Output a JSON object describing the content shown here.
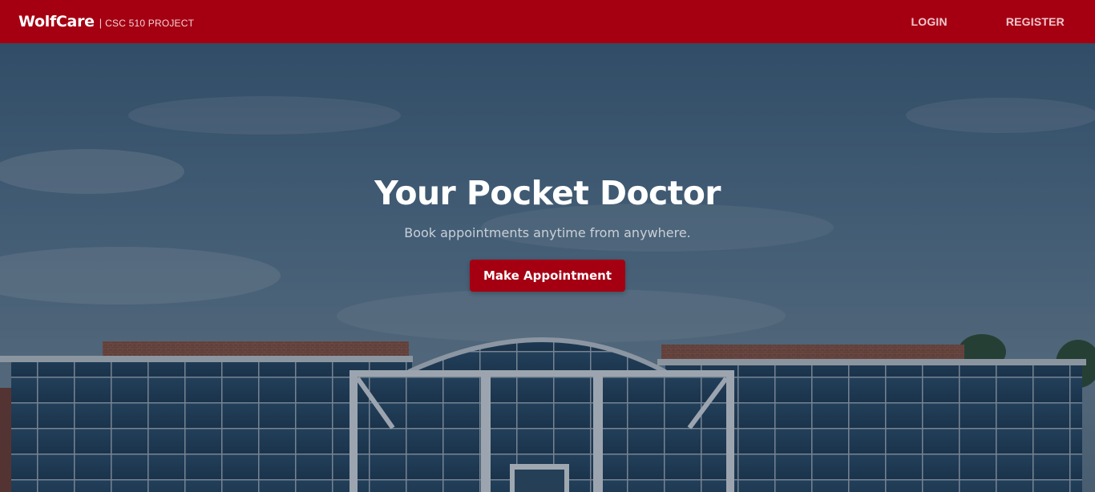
{
  "nav": {
    "brand": "WolfCare",
    "separator": "|",
    "subtitle": "CSC 510 PROJECT",
    "login": "LOGIN",
    "register": "REGISTER"
  },
  "hero": {
    "title": "Your Pocket Doctor",
    "subtitle": "Book appointments anytime from anywhere.",
    "cta": "Make Appointment",
    "background": "campus-building-photo"
  },
  "colors": {
    "brand_red": "#a50012",
    "white": "#ffffff",
    "nav_link": "#f0c9ce"
  }
}
